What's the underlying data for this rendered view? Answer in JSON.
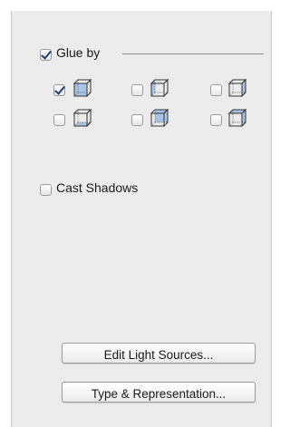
{
  "glue_by": {
    "label": "Glue by",
    "checked": true,
    "options": [
      {
        "icon": "cube-glue-front-icon",
        "checked": true
      },
      {
        "icon": "cube-glue-left-icon",
        "checked": false
      },
      {
        "icon": "cube-glue-right-icon",
        "checked": false
      },
      {
        "icon": "cube-glue-bottom-icon",
        "checked": false
      },
      {
        "icon": "cube-glue-back-icon",
        "checked": false
      },
      {
        "icon": "cube-glue-top-icon",
        "checked": false
      }
    ]
  },
  "cast_shadows": {
    "label": "Cast Shadows",
    "checked": false
  },
  "buttons": {
    "edit_light_sources": "Edit Light Sources...",
    "type_representation": "Type & Representation..."
  },
  "colors": {
    "panel_bg": "#ececec",
    "check_mark": "#1d3f7a",
    "cube_highlight": "#a8c3e6"
  }
}
